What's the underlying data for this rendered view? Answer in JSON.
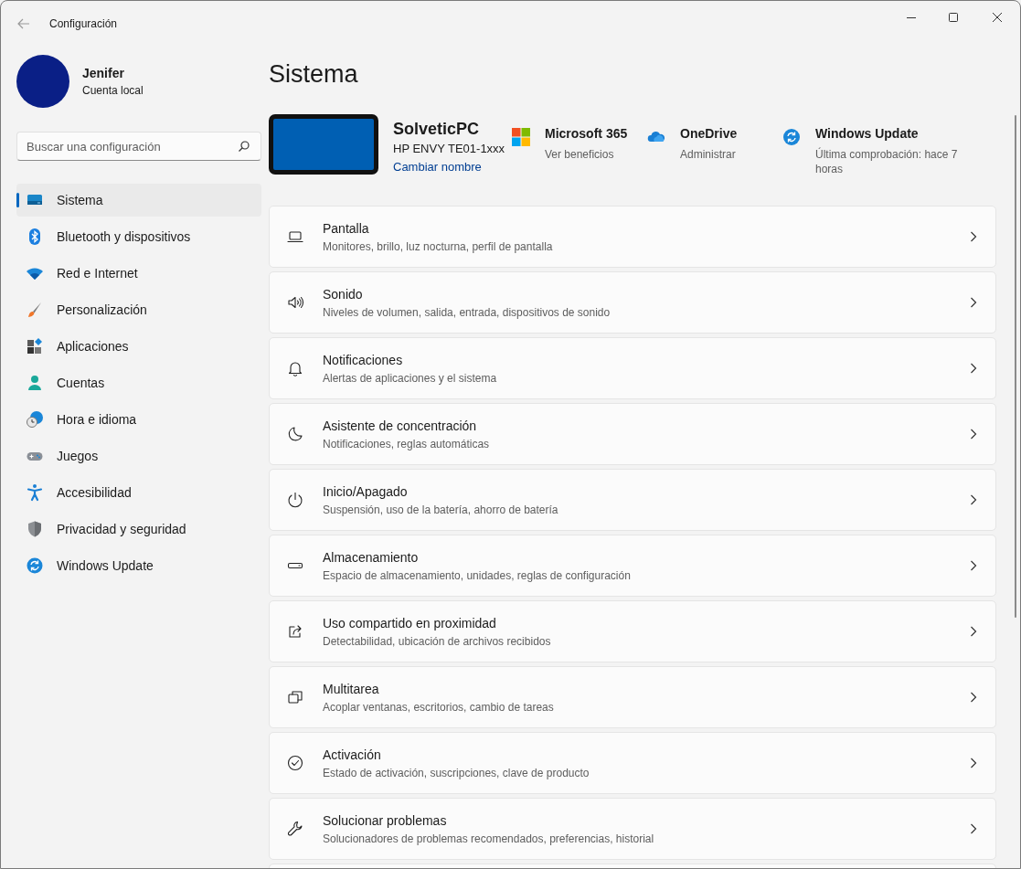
{
  "window": {
    "title": "Configuración"
  },
  "account": {
    "name": "Jenifer",
    "type": "Cuenta local"
  },
  "search": {
    "placeholder": "Buscar una configuración"
  },
  "sidebar": {
    "items": [
      {
        "label": "Sistema",
        "selected": true
      },
      {
        "label": "Bluetooth y dispositivos",
        "selected": false
      },
      {
        "label": "Red e Internet",
        "selected": false
      },
      {
        "label": "Personalización",
        "selected": false
      },
      {
        "label": "Aplicaciones",
        "selected": false
      },
      {
        "label": "Cuentas",
        "selected": false
      },
      {
        "label": "Hora e idioma",
        "selected": false
      },
      {
        "label": "Juegos",
        "selected": false
      },
      {
        "label": "Accesibilidad",
        "selected": false
      },
      {
        "label": "Privacidad y seguridad",
        "selected": false
      },
      {
        "label": "Windows Update",
        "selected": false
      }
    ]
  },
  "page": {
    "title": "Sistema",
    "device": {
      "name": "SolveticPC",
      "model": "HP ENVY TE01-1xxx",
      "rename_link": "Cambiar nombre"
    },
    "services": [
      {
        "title": "Microsoft 365",
        "subtitle": "Ver beneficios"
      },
      {
        "title": "OneDrive",
        "subtitle": "Administrar"
      },
      {
        "title": "Windows Update",
        "subtitle": "Última comprobación: hace 7 horas"
      }
    ],
    "settings": [
      {
        "title": "Pantalla",
        "subtitle": "Monitores, brillo, luz nocturna, perfil de pantalla"
      },
      {
        "title": "Sonido",
        "subtitle": "Niveles de volumen, salida, entrada, dispositivos de sonido"
      },
      {
        "title": "Notificaciones",
        "subtitle": "Alertas de aplicaciones y el sistema"
      },
      {
        "title": "Asistente de concentración",
        "subtitle": "Notificaciones, reglas automáticas"
      },
      {
        "title": "Inicio/Apagado",
        "subtitle": "Suspensión, uso de la batería, ahorro de batería"
      },
      {
        "title": "Almacenamiento",
        "subtitle": "Espacio de almacenamiento, unidades, reglas de configuración"
      },
      {
        "title": "Uso compartido en proximidad",
        "subtitle": "Detectabilidad, ubicación de archivos recibidos"
      },
      {
        "title": "Multitarea",
        "subtitle": "Acoplar ventanas, escritorios, cambio de tareas"
      },
      {
        "title": "Activación",
        "subtitle": "Estado de activación, suscripciones, clave de producto"
      },
      {
        "title": "Solucionar problemas",
        "subtitle": "Solucionadores de problemas recomendados, preferencias, historial"
      }
    ]
  }
}
